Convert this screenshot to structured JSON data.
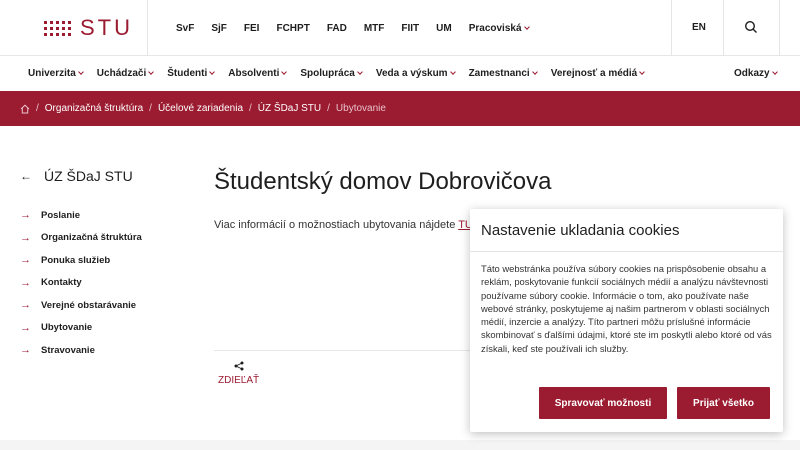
{
  "header": {
    "logo_text": "STU",
    "faculties": [
      "SvF",
      "SjF",
      "FEI",
      "FCHPT",
      "FAD",
      "MTF",
      "FIIT",
      "UM",
      "Pracoviská"
    ],
    "language": "EN"
  },
  "nav": {
    "items": [
      "Univerzita",
      "Uchádzači",
      "Študenti",
      "Absolventi",
      "Spolupráca",
      "Veda a výskum",
      "Zamestnanci",
      "Verejnosť a médiá"
    ],
    "right": "Odkazy"
  },
  "breadcrumb": {
    "items": [
      "Organizačná štruktúra",
      "Účelové zariadenia",
      "ÚZ ŠDaJ STU"
    ],
    "current": "Ubytovanie"
  },
  "sidebar": {
    "title": "ÚZ ŠDaJ STU",
    "items": [
      "Poslanie",
      "Organizačná štruktúra",
      "Ponuka služieb",
      "Kontakty",
      "Verejné obstarávanie",
      "Ubytovanie",
      "Stravovanie"
    ]
  },
  "main": {
    "title": "Študentský domov Dobrovičova",
    "intro_prefix": "Viac informácií o možnostiach ubytovania nájdete",
    "intro_link": "TU",
    "intro_suffix": ".",
    "share_label": "ZDIEĽAŤ"
  },
  "cookie": {
    "title": "Nastavenie ukladania cookies",
    "text": "Táto webstránka používa súbory cookies na prispôsobenie obsahu a reklám, poskytovanie funkcií sociálnych médií a analýzu návštevnosti používame súbory cookie. Informácie o tom, ako používate naše webové stránky, poskytujeme aj našim partnerom v oblasti sociálnych médií, inzercie a analýzy. Títo partneri môžu príslušné informácie skombinovať s ďalšími údajmi, ktoré ste im poskytli alebo ktoré od vás získali, keď ste používali ich služby.",
    "settings_label": "Spravovať možnosti",
    "accept_label": "Prijať všetko"
  },
  "colors": {
    "brand": "#9b1b30"
  },
  "icons": [
    "search-icon",
    "home-icon",
    "back-arrow-icon",
    "arrow-right-icon",
    "share-icon"
  ]
}
